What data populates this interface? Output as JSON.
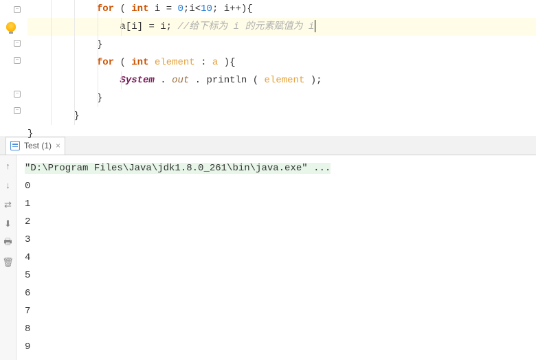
{
  "editor": {
    "lines": [
      {
        "indent": 3,
        "tokens": [
          {
            "t": "kw",
            "v": "for"
          },
          {
            "t": "punc",
            "v": " ( "
          },
          {
            "t": "type",
            "v": "int"
          },
          {
            "t": "punc",
            "v": " "
          },
          {
            "t": "var",
            "v": "i"
          },
          {
            "t": "punc",
            "v": " = "
          },
          {
            "t": "num",
            "v": "0"
          },
          {
            "t": "punc",
            "v": ";"
          },
          {
            "t": "var",
            "v": "i"
          },
          {
            "t": "punc",
            "v": "<"
          },
          {
            "t": "num",
            "v": "10"
          },
          {
            "t": "punc",
            "v": "; "
          },
          {
            "t": "var",
            "v": "i"
          },
          {
            "t": "punc",
            "v": "++){"
          }
        ]
      },
      {
        "indent": 4,
        "highlighted": true,
        "cursor": true,
        "tokens": [
          {
            "t": "var",
            "v": "a"
          },
          {
            "t": "punc",
            "v": "["
          },
          {
            "t": "var",
            "v": "i"
          },
          {
            "t": "punc",
            "v": "] = "
          },
          {
            "t": "var",
            "v": "i"
          },
          {
            "t": "punc",
            "v": "; "
          },
          {
            "t": "comment",
            "v": "//给下标为 i 的元素赋值为 i"
          }
        ]
      },
      {
        "indent": 3,
        "tokens": [
          {
            "t": "punc",
            "v": "}"
          }
        ]
      },
      {
        "indent": 3,
        "tokens": [
          {
            "t": "kw",
            "v": "for"
          },
          {
            "t": "punc",
            "v": " ( "
          },
          {
            "t": "type",
            "v": "int"
          },
          {
            "t": "punc",
            "v": " "
          },
          {
            "t": "param",
            "v": "element"
          },
          {
            "t": "punc",
            "v": " : "
          },
          {
            "t": "param",
            "v": "a"
          },
          {
            "t": "punc",
            "v": " ){"
          }
        ]
      },
      {
        "indent": 4,
        "tokens": [
          {
            "t": "field",
            "v": "System"
          },
          {
            "t": "punc",
            "v": " . "
          },
          {
            "t": "field-static",
            "v": "out"
          },
          {
            "t": "punc",
            "v": " . "
          },
          {
            "t": "method",
            "v": "println"
          },
          {
            "t": "punc",
            "v": " ( "
          },
          {
            "t": "param",
            "v": "element"
          },
          {
            "t": "punc",
            "v": " );"
          }
        ]
      },
      {
        "indent": 3,
        "tokens": [
          {
            "t": "punc",
            "v": "}"
          }
        ]
      },
      {
        "indent": 2,
        "tokens": [
          {
            "t": "punc",
            "v": "}"
          }
        ]
      },
      {
        "indent": 0,
        "tokens": [
          {
            "t": "punc",
            "v": "}"
          }
        ]
      }
    ],
    "fold_rows": [
      0,
      2,
      3,
      5,
      6
    ],
    "bulb_row": 1
  },
  "run_panel": {
    "tab_label": "Test (1)",
    "cmd": "\"D:\\Program Files\\Java\\jdk1.8.0_261\\bin\\java.exe\" ...",
    "output": [
      "0",
      "1",
      "2",
      "3",
      "4",
      "5",
      "6",
      "7",
      "8",
      "9"
    ]
  },
  "toolbar_icons": [
    "↑",
    "↓",
    "⇄",
    "⬇",
    "🖶",
    "🗑"
  ]
}
